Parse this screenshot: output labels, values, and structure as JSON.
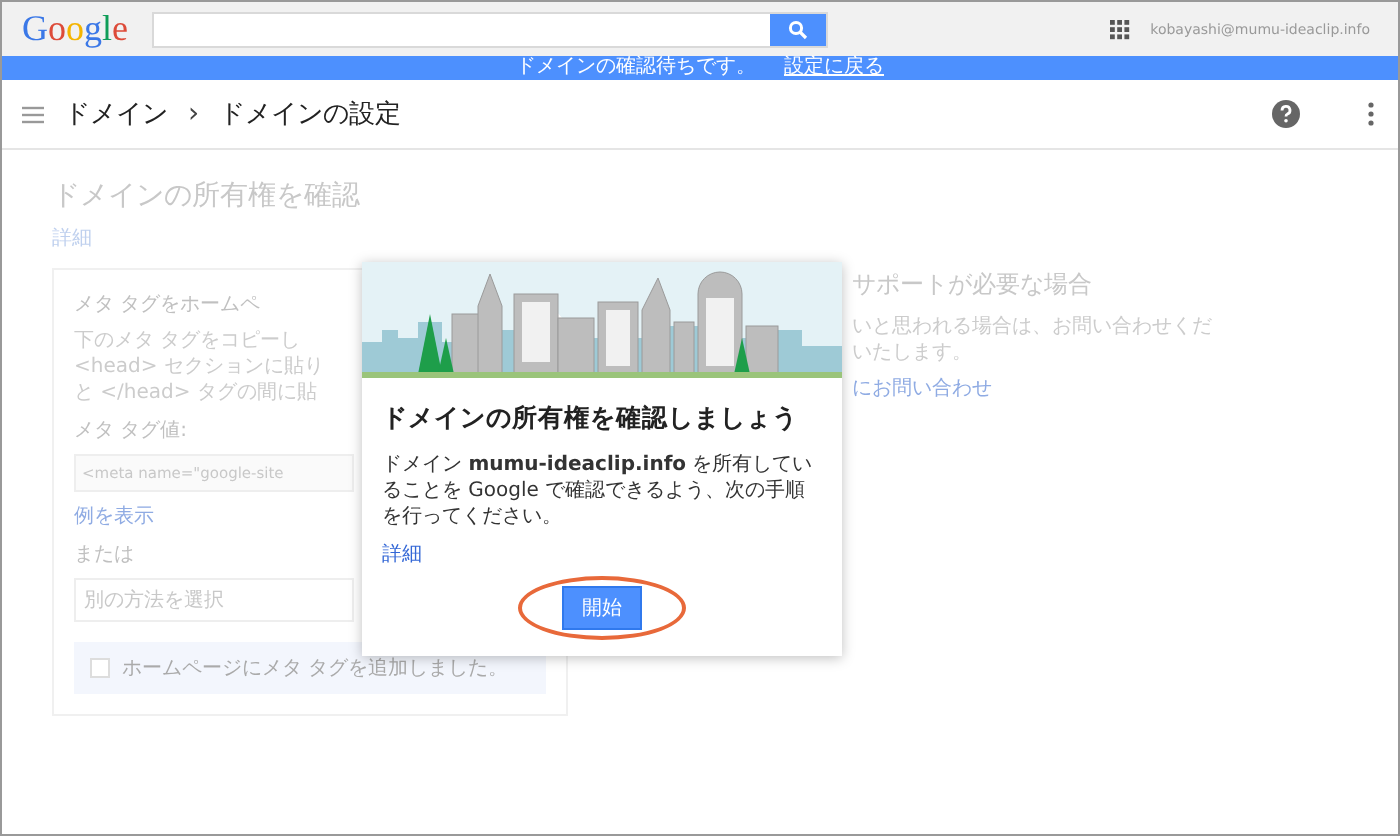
{
  "top_bar": {
    "logo": "Google",
    "account": "kobayashi@mumu-ideaclip.info"
  },
  "banner": {
    "message": "ドメインの確認待ちです。",
    "link": "設定に戻る"
  },
  "header": {
    "breadcrumbs": [
      "ドメイン",
      "ドメインの設定"
    ],
    "separator": "›"
  },
  "background_page": {
    "title": "ドメインの所有権を確認",
    "link": "詳細",
    "card": {
      "heading": "メタ タグをホームペ",
      "paragraph_lines": [
        "下のメタ タグをコピーし",
        "<head> セクションに貼り",
        "と </head> タグの間に貼"
      ],
      "meta_tag_label": "メタ タグ値:",
      "meta_tag_value": "<meta name=\"google-site",
      "example_link": "例を表示",
      "or_label": "または",
      "method_select": "別の方法を選択",
      "checkbox": {
        "label": "ホームページにメタ タグを追加しました。",
        "checked": false
      }
    },
    "support": {
      "title": "サポートが必要な場合",
      "lines": [
        "いと思われる場合は、お問い合わせくだ",
        "いたします。"
      ],
      "link": "にお問い合わせ"
    }
  },
  "dialog": {
    "title": "ドメインの所有権を確認しましょう",
    "body": "ドメイン **mumu-ideaclip.info** を所有していることを Google で確認できるよう、次の手順を行ってください。",
    "link": "詳細",
    "button": "開始",
    "highlighted": true
  }
}
